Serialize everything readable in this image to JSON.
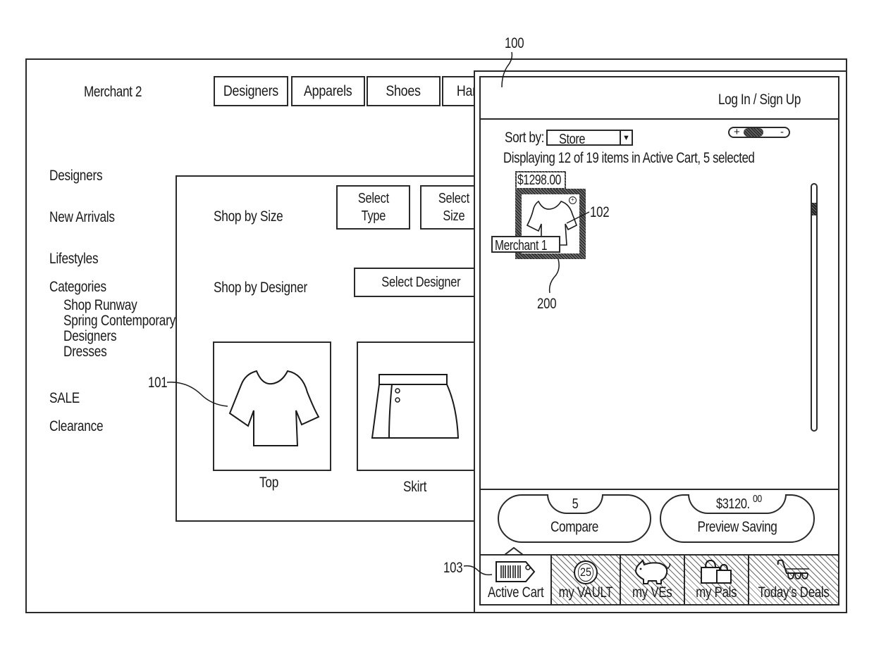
{
  "merchant_window": {
    "title": "Merchant 2",
    "nav_tabs": [
      "Designers",
      "Apparels",
      "Shoes",
      "Han"
    ],
    "sidebar": {
      "items": [
        "Designers",
        "New Arrivals",
        "Lifestyles",
        "Categories"
      ],
      "category_subitems": [
        "Shop Runway",
        "Spring Contemporary",
        "Designers",
        "Dresses"
      ],
      "bottom_items": [
        "SALE",
        "Clearance"
      ]
    },
    "content": {
      "shop_by_size_label": "Shop by Size",
      "select_type_label": "Select\nType",
      "select_size_label": "Select\nSize",
      "shop_by_designer_label": "Shop by Designer",
      "select_designer_label": "Select Designer",
      "products": [
        {
          "name": "Top",
          "icon": "shirt-icon"
        },
        {
          "name": "Skirt",
          "icon": "skirt-icon"
        }
      ]
    }
  },
  "cart_panel": {
    "auth_link": "Log In  /  Sign Up",
    "sort_label": "Sort by:",
    "sort_value": "Store",
    "zoom_toggle": {
      "plus": "+",
      "minus": "-"
    },
    "status_text": "Displaying 12 of 19 items in Active Cart, 5 selected",
    "cart_item": {
      "price": "$1298.00",
      "merchant": "Merchant 1",
      "icon": "shirt-icon"
    },
    "compare": {
      "count": "5",
      "label": "Compare"
    },
    "preview_saving": {
      "amount": "$3120.",
      "cents": "00",
      "label": "Preview Saving"
    },
    "bottom_tabs": [
      {
        "label": "Active Cart",
        "icon": "barcode-tag-icon",
        "active": true
      },
      {
        "label": "my VAULT",
        "icon": "coin-icon",
        "badge": "25",
        "active": false
      },
      {
        "label": "my VEs",
        "icon": "piggy-bank-icon",
        "active": false
      },
      {
        "label": "my Pals",
        "icon": "shopping-bags-icon",
        "active": false
      },
      {
        "label": "Today's Deals",
        "icon": "shopping-cart-icon",
        "active": false
      }
    ]
  },
  "reference_numerals": {
    "panel": "100",
    "product_top": "101",
    "cart_item_image": "102",
    "active_cart_tab": "103",
    "cart_item": "200"
  }
}
